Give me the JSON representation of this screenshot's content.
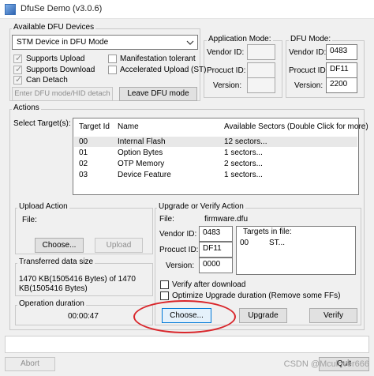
{
  "window": {
    "title": "DfuSe Demo (v3.0.6)"
  },
  "available": {
    "legend": "Available DFU Devices",
    "device": "STM Device in DFU Mode",
    "supports_upload": "Supports Upload",
    "supports_download": "Supports Download",
    "can_detach": "Can Detach",
    "manifestation": "Manifestation tolerant",
    "accelerated": "Accelerated Upload (ST)",
    "enter_dfu": "Enter DFU mode/HID detach",
    "leave_dfu": "Leave DFU mode"
  },
  "app_mode": {
    "legend": "Application Mode:",
    "vendor_label": "Vendor ID:",
    "product_label": "Procuct ID:",
    "version_label": "Version:",
    "vendor": "",
    "product": "",
    "version": ""
  },
  "dfu_mode": {
    "legend": "DFU Mode:",
    "vendor_label": "Vendor ID:",
    "product_label": "Procuct ID:",
    "version_label": "Version:",
    "vendor": "0483",
    "product": "DF11",
    "version": "2200"
  },
  "actions": {
    "legend": "Actions",
    "select_label": "Select Target(s):",
    "columns": [
      "Target Id",
      "Name",
      "Available Sectors (Double Click for more)"
    ],
    "targets": [
      [
        "00",
        "Internal Flash",
        "12 sectors..."
      ],
      [
        "01",
        "Option Bytes",
        "1 sectors..."
      ],
      [
        "02",
        "OTP Memory",
        "2 sectors..."
      ],
      [
        "03",
        "Device Feature",
        "1 sectors..."
      ]
    ]
  },
  "upload": {
    "legend": "Upload Action",
    "file_label": "File:",
    "choose": "Choose...",
    "upload": "Upload"
  },
  "transferred": {
    "legend": "Transferred data size",
    "line1": "1470 KB(1505416 Bytes) of 1470",
    "line2": "KB(1505416 Bytes)"
  },
  "duration": {
    "legend": "Operation duration",
    "value": "00:00:47"
  },
  "upgrade": {
    "legend": "Upgrade or Verify Action",
    "file_label": "File:",
    "file": "firmware.dfu",
    "vendor_label": "Vendor ID:",
    "product_label": "Procuct ID:",
    "version_label": "Version:",
    "vendor": "0483",
    "product": "DF11",
    "version": "0000",
    "targets_label": "Targets in file:",
    "target_id": "00",
    "target_name": "ST...",
    "verify_after": "Verify after download",
    "optimize": "Optimize Upgrade duration (Remove some FFs)",
    "choose": "Choose...",
    "upgrade": "Upgrade",
    "verify": "Verify"
  },
  "bottom": {
    "abort": "Abort",
    "quit": "Quit"
  },
  "watermark": "CSDN @Mculover666"
}
